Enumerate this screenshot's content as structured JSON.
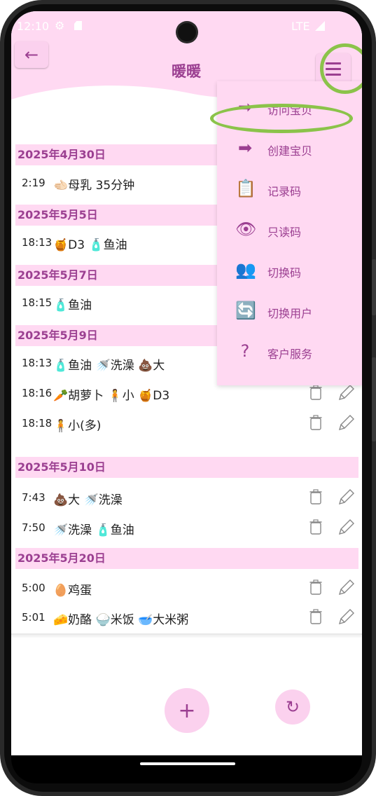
{
  "status_bar": {
    "time": "12:10",
    "network": "LTE"
  },
  "app": {
    "title": "暖暖",
    "back_glyph": "←",
    "menu_icon": "hamburger-menu-icon"
  },
  "groups": [
    {
      "date": "2025年4月30日",
      "entries": [
        {
          "time": "2:19",
          "desc": "🫲🏻母乳 35分钟"
        }
      ]
    },
    {
      "date": "2025年5月5日",
      "entries": [
        {
          "time": "18:13",
          "desc": "🍯D3 🧴鱼油"
        }
      ]
    },
    {
      "date": "2025年5月7日",
      "entries": [
        {
          "time": "18:15",
          "desc": "🧴鱼油"
        }
      ]
    },
    {
      "date": "2025年5月9日",
      "entries": [
        {
          "time": "18:13",
          "desc": "🧴鱼油 🚿洗澡 💩大"
        },
        {
          "time": "18:16",
          "desc": "🥕胡萝卜 🧍小 🍯D3"
        },
        {
          "time": "18:18",
          "desc": "🧍小(多)"
        }
      ]
    },
    {
      "date": "2025年5月10日",
      "entries": [
        {
          "time": "7:43",
          "desc": "💩大 🚿洗澡"
        },
        {
          "time": "7:50",
          "desc": "🚿洗澡 🧴鱼油"
        }
      ]
    },
    {
      "date": "2025年5月20日",
      "entries": [
        {
          "time": "5:00",
          "desc": "🥚鸡蛋"
        },
        {
          "time": "5:01",
          "desc": "🧀奶酪 🍚米饭 🥣大米粥"
        }
      ]
    }
  ],
  "menu": [
    {
      "label": "访问宝贝",
      "icon": "arrow-right-icon",
      "glyph": "➡"
    },
    {
      "label": "创建宝贝",
      "icon": "arrow-right-icon",
      "glyph": "➡"
    },
    {
      "label": "记录码",
      "icon": "clipboard-edit-icon",
      "glyph": "📋"
    },
    {
      "label": "只读码",
      "icon": "eye-icon",
      "glyph": "👁"
    },
    {
      "label": "切换码",
      "icon": "people-icon",
      "glyph": "👥"
    },
    {
      "label": "切换用户",
      "icon": "sync-icon",
      "glyph": "🔄"
    },
    {
      "label": "客户服务",
      "icon": "question-mark-icon",
      "glyph": "?"
    }
  ],
  "fab": {
    "add_glyph": "+",
    "refresh_glyph": "↻"
  },
  "colors": {
    "accent": "#9b3f91",
    "header_bg": "#ffd9f2",
    "highlight_ring": "#8bc34a"
  }
}
